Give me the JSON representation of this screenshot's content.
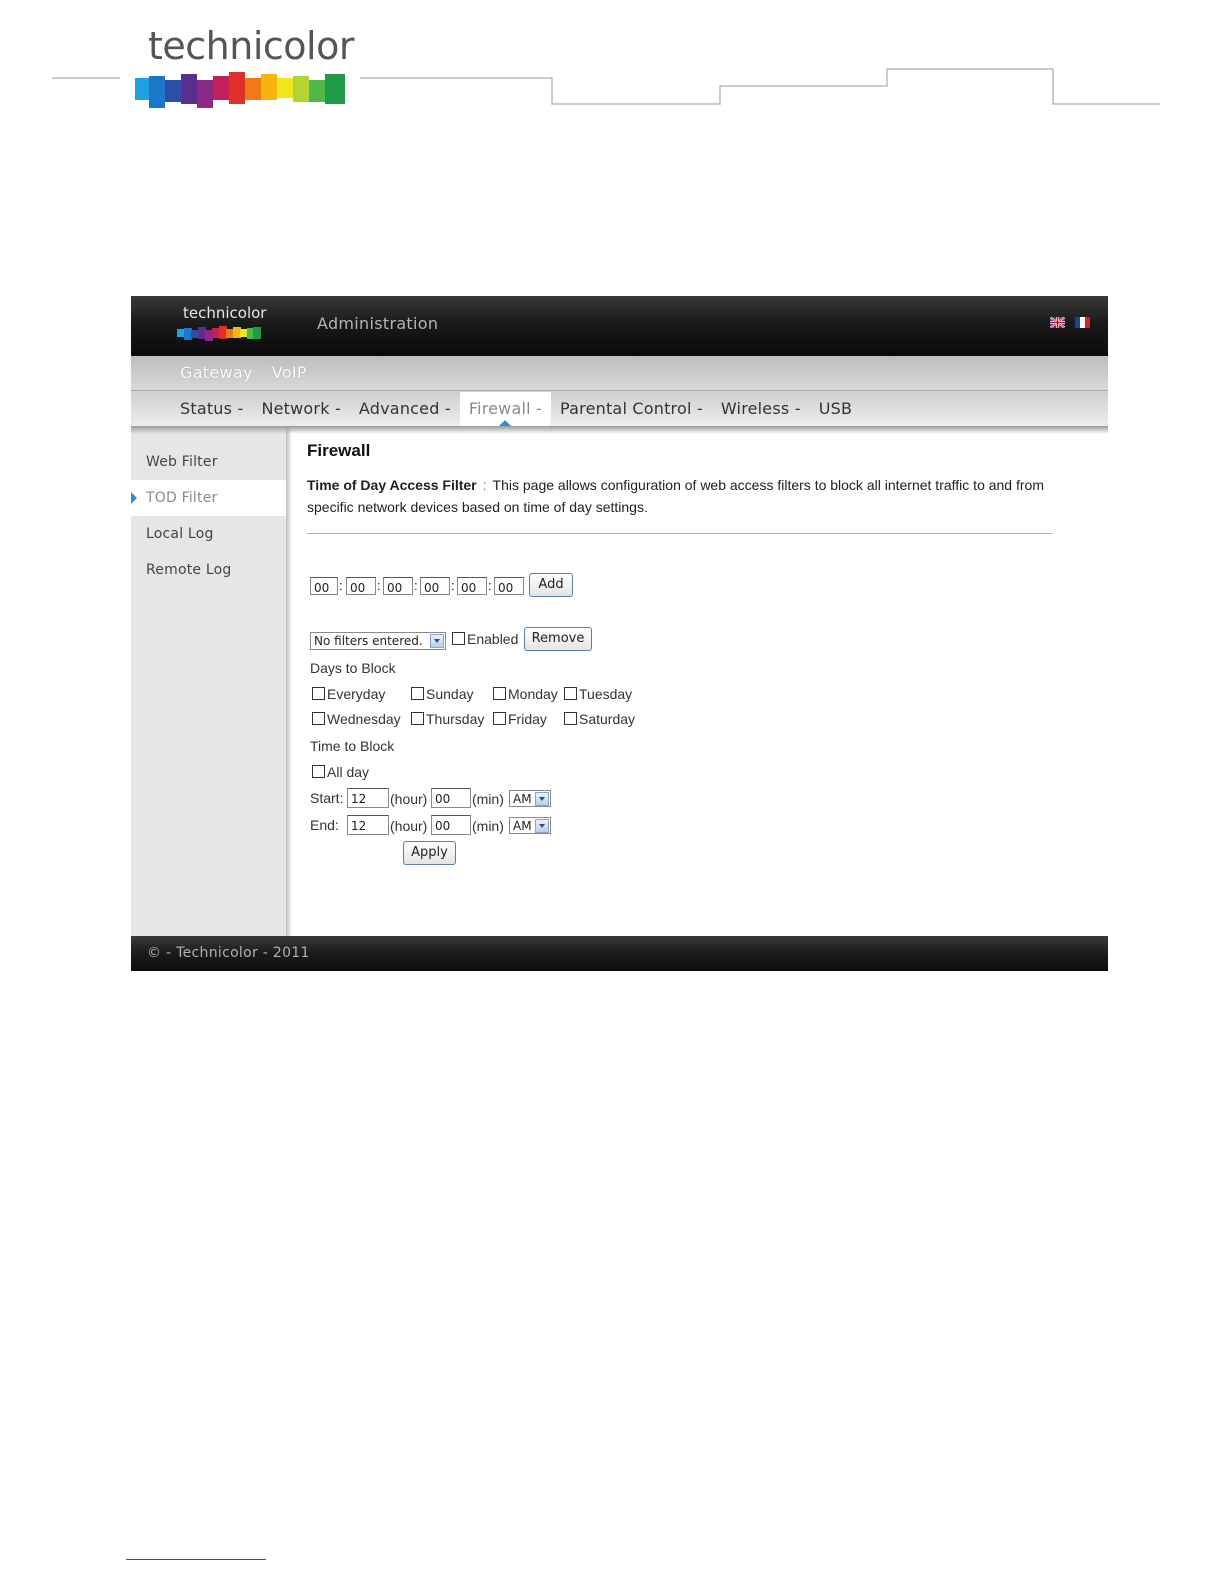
{
  "doc_header": {
    "logo_text": "technicolor"
  },
  "topbar": {
    "logo_text": "technicolor",
    "title": "Administration"
  },
  "menu": {
    "primary": [
      {
        "label": "Gateway"
      },
      {
        "label": "VoIP"
      }
    ],
    "secondary": [
      {
        "label": "Status -"
      },
      {
        "label": "Network -"
      },
      {
        "label": "Advanced -"
      },
      {
        "label": "Firewall -",
        "active": true
      },
      {
        "label": "Parental Control -"
      },
      {
        "label": "Wireless -"
      },
      {
        "label": "USB"
      }
    ]
  },
  "sidebar": {
    "items": [
      {
        "label": "Web Filter"
      },
      {
        "label": "TOD Filter",
        "active": true
      },
      {
        "label": "Local Log"
      },
      {
        "label": "Remote Log"
      }
    ]
  },
  "main": {
    "title": "Firewall",
    "desc_bold": "Time of Day Access Filter",
    "desc_sep": ":",
    "desc_text": "This page allows configuration of web access filters to block all internet traffic to and from specific network devices based on time of day settings.",
    "mac_fields": [
      "00",
      "00",
      "00",
      "00",
      "00",
      "00"
    ],
    "mac_sep": ":",
    "add_label": "Add",
    "filter_select": "No filters entered.",
    "enabled_label": "Enabled",
    "remove_label": "Remove",
    "days_heading": "Days to Block",
    "days": [
      "Everyday",
      "Sunday",
      "Monday",
      "Tuesday",
      "Wednesday",
      "Thursday",
      "Friday",
      "Saturday"
    ],
    "time_heading": "Time to Block",
    "allday_label": "All day",
    "start_label": "Start:",
    "end_label": "End:",
    "hour_label": "(hour)",
    "min_label": "(min)",
    "start_hour": "12",
    "start_min": "00",
    "start_ampm": "AM",
    "end_hour": "12",
    "end_min": "00",
    "end_ampm": "AM",
    "apply_label": "Apply"
  },
  "footer": {
    "text": "© - Technicolor - 2011"
  },
  "colors": {
    "accent": "#2a8fd6",
    "topbar": "#1a1a1a",
    "sidebar": "#e6e6e6"
  }
}
